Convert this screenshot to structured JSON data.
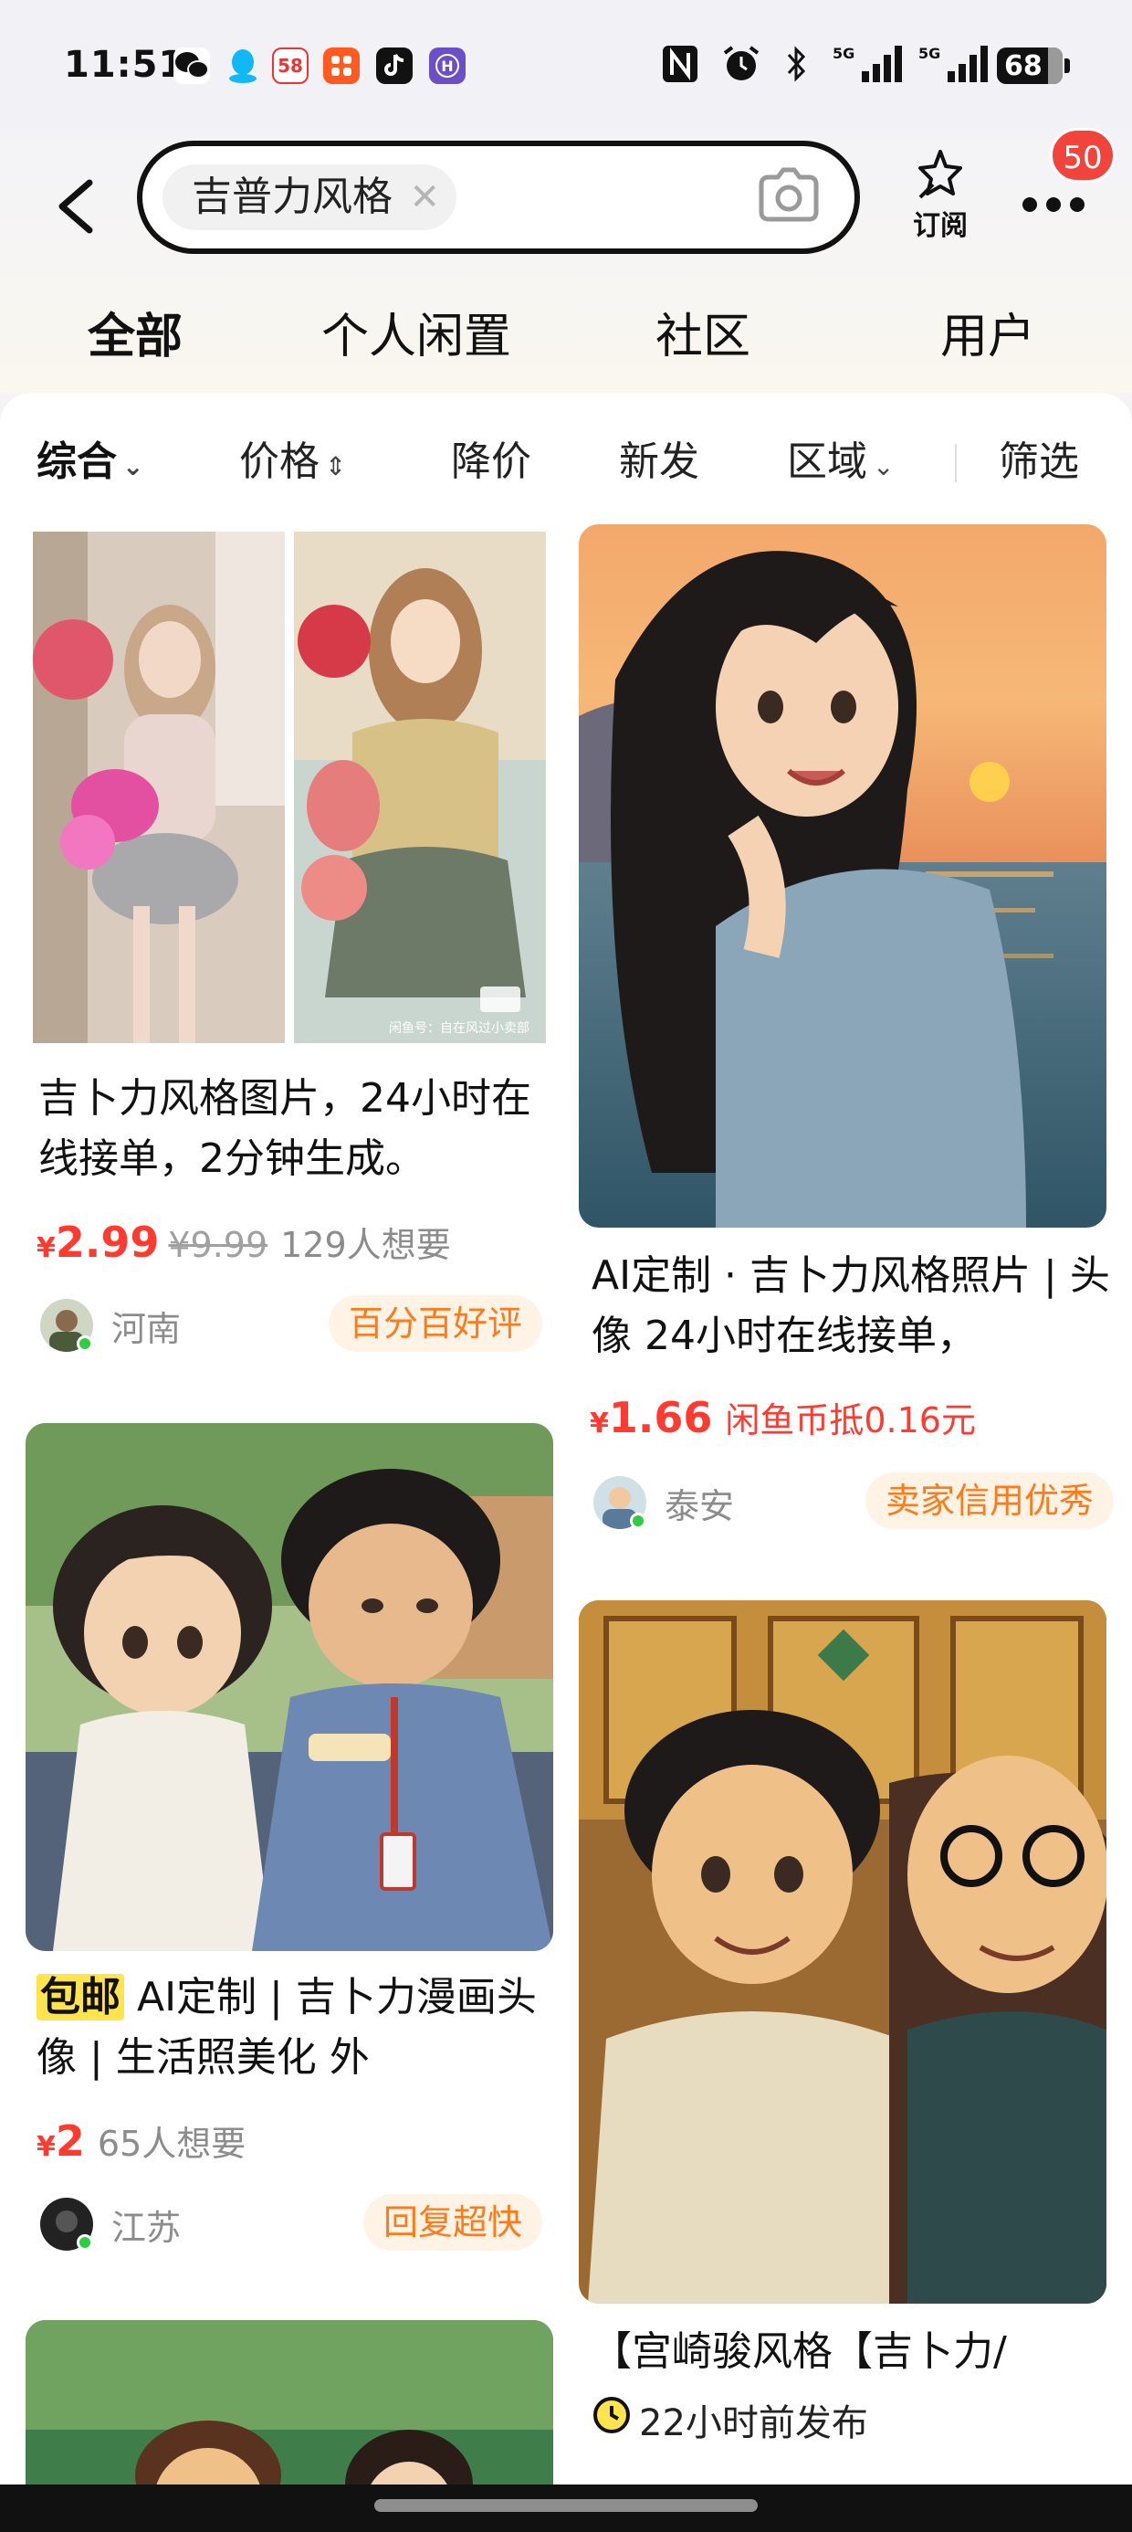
{
  "status": {
    "time": "11:51",
    "battery": "68",
    "network1": "5G",
    "network2": "5G",
    "app_icons": [
      "wechat-icon",
      "qq-icon",
      "58-icon",
      "taobao-icon",
      "tiktok-icon",
      "h-app-icon"
    ],
    "app_58_label": "58"
  },
  "search": {
    "query": "吉普力风格",
    "subscribe_label": "订阅",
    "badge_count": "50"
  },
  "tabs": [
    {
      "label": "全部",
      "active": true
    },
    {
      "label": "个人闲置"
    },
    {
      "label": "社区"
    },
    {
      "label": "用户"
    }
  ],
  "filters": [
    {
      "label": "综合",
      "arrow": "⌄",
      "active": true
    },
    {
      "label": "价格",
      "arrow": "⇕"
    },
    {
      "label": "降价"
    },
    {
      "label": "新发"
    },
    {
      "label": "区域",
      "arrow": "⌄"
    },
    {
      "label": "筛选"
    }
  ],
  "cards": [
    {
      "title": "吉卜力风格图片，24小时在线接单，2分钟生成。",
      "currency": "¥",
      "price": "2.99",
      "old_price": "¥9.99",
      "want": "129人想要",
      "region": "河南",
      "tag": "百分百好评",
      "watermark": "闲鱼号：自在风过小卖部"
    },
    {
      "title": "AI定制 · 吉卜力风格照片 | 头像 24小时在线接单，",
      "currency": "¥",
      "price": "1.66",
      "coin": "闲鱼币抵0.16元",
      "region": "泰安",
      "tag": "卖家信用优秀"
    },
    {
      "free_ship": "包邮",
      "title": "AI定制 | 吉卜力漫画头像 | 生活照美化 外",
      "currency": "¥",
      "price": "2",
      "want": "65人想要",
      "region": "江苏",
      "tag": "回复超快"
    },
    {
      "title": "【宫崎骏风格【吉卜力/",
      "time": "22小时前发布"
    }
  ],
  "colors": {
    "price": "#ff3b30",
    "tag_text": "#ff7a1a",
    "tag_bg": "#fff3e6",
    "highlight": "#ffe44d",
    "badge": "#f0443c"
  }
}
